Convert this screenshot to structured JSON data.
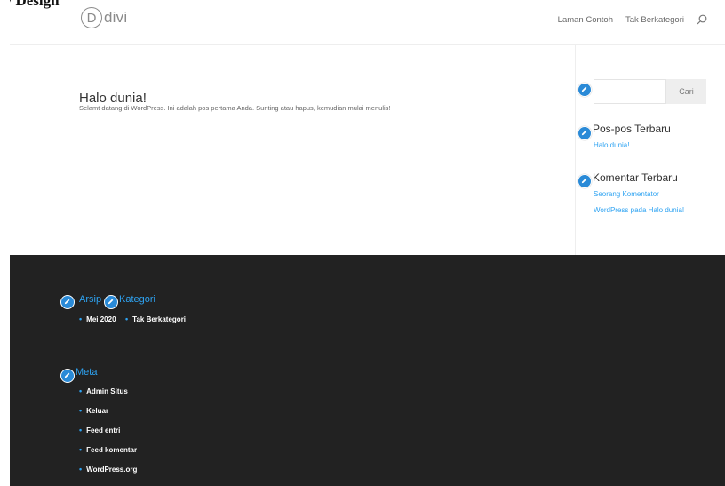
{
  "document_heading": "ly Design",
  "header": {
    "logo_letter": "D",
    "logo_text": "divi",
    "nav": [
      "Laman Contoh",
      "Tak Berkategori"
    ],
    "search_icon": "search-icon"
  },
  "post": {
    "title": "Halo dunia!",
    "excerpt": "Selamt datang di WordPress. Ini adalah pos pertama Anda. Sunting atau hapus, kemudian mulai menulis!"
  },
  "sidebar": {
    "search_button": "Cari",
    "recent_posts_title": "Pos-pos Terbaru",
    "recent_posts": [
      "Halo dunia!"
    ],
    "recent_comments_title": "Komentar Terbaru",
    "recent_comment_line1": "Seorang Komentator",
    "recent_comment_line2": "WordPress pada Halo dunia!"
  },
  "footer": {
    "archives_title": "Arsip",
    "categories_title": "Kategori",
    "archives": [
      "Mei 2020"
    ],
    "categories": [
      "Tak Berkategori"
    ],
    "meta_title": "Meta",
    "meta_links": [
      "Admin Situs",
      "Keluar",
      "Feed entri",
      "Feed komentar",
      "WordPress.org"
    ]
  },
  "colors": {
    "accent": "#2ea3f2",
    "edit_badge": "#2a8ad7",
    "footer_bg": "#222222"
  }
}
